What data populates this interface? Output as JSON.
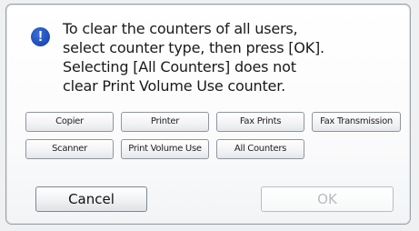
{
  "dialog": {
    "icon": "exclamation-icon",
    "icon_glyph": "!",
    "message_lines": [
      "To clear the counters of all users,",
      "select counter type, then press [OK].",
      "Selecting [All Counters] does not",
      "clear Print Volume Use counter."
    ]
  },
  "counter_buttons": {
    "copier": "Copier",
    "printer": "Printer",
    "fax_prints": "Fax Prints",
    "fax_transmission": "Fax Transmission",
    "scanner": "Scanner",
    "print_volume_use": "Print Volume Use",
    "all_counters": "All Counters"
  },
  "actions": {
    "cancel": "Cancel",
    "ok": "OK"
  },
  "colors": {
    "icon_blue": "#1d4bb5",
    "disabled_text": "#b8bcc0"
  }
}
